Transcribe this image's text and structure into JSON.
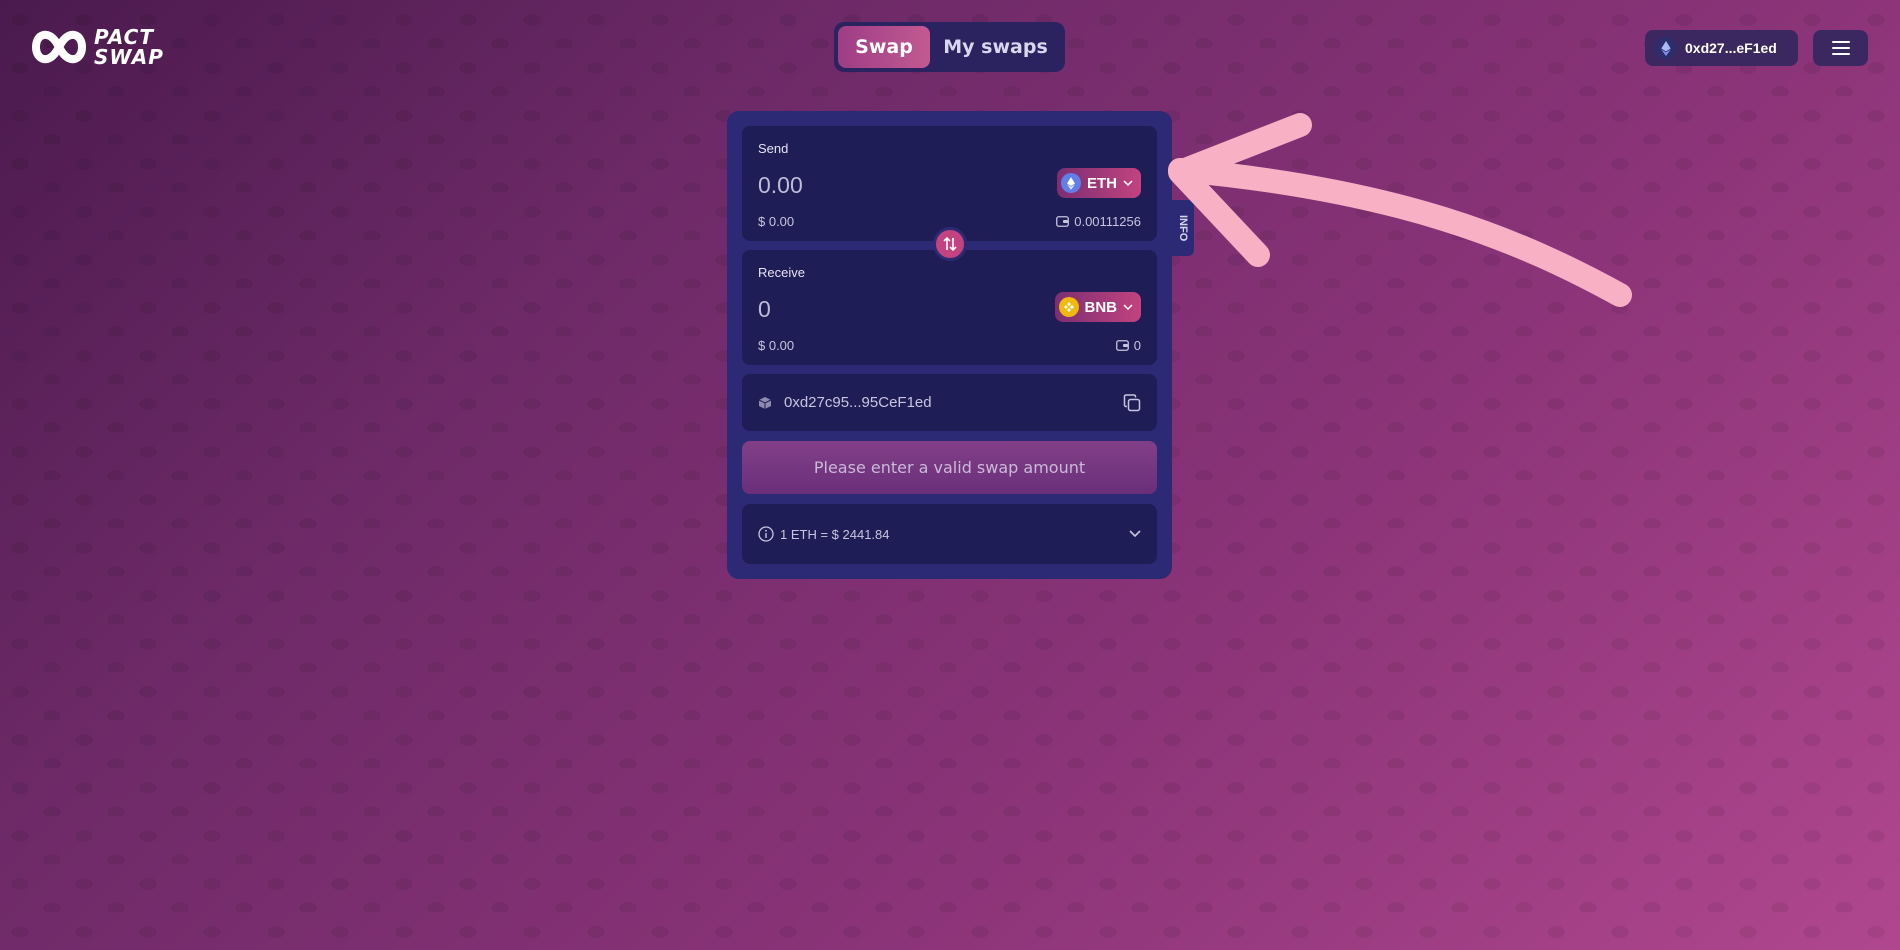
{
  "brand": {
    "line1": "PACT",
    "line2": "SWAP"
  },
  "tabs": [
    {
      "label": "Swap",
      "active": true
    },
    {
      "label": "My swaps",
      "active": false
    }
  ],
  "wallet": {
    "address": "0xd27...eF1ed",
    "icon": "ethereum-icon"
  },
  "menu": {
    "icon": "hamburger-icon"
  },
  "swap": {
    "send": {
      "label": "Send",
      "amount": "0.00",
      "usd": "$ 0.00",
      "balance": "0.00111256",
      "token": "ETH"
    },
    "receive": {
      "label": "Receive",
      "amount": "0",
      "usd": "$ 0.00",
      "balance": "0",
      "token": "BNB"
    },
    "recipient_address": "0xd27c95...95CeF1ed",
    "action_label": "Please enter a valid swap amount",
    "rate": "1 ETH = $ 2441.84",
    "side_tab": "INFO"
  },
  "colors": {
    "accent": "#c2437f",
    "card": "#2c2a74",
    "panel": "#1f1d55",
    "annotation_arrow": "#f7b0c4"
  }
}
